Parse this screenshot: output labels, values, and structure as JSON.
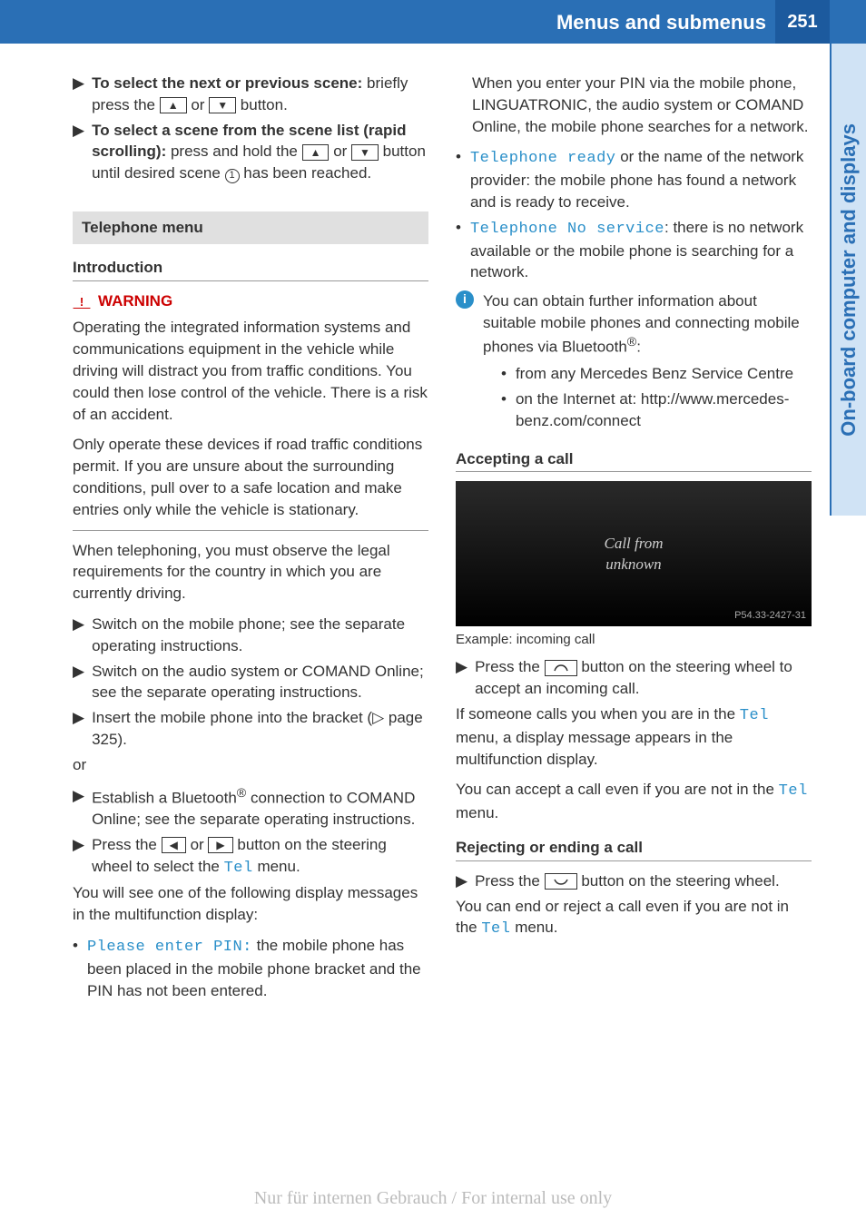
{
  "header": {
    "title": "Menus and submenus",
    "page_number": "251"
  },
  "side_tab": "On-board computer and displays",
  "left_col": {
    "instr1_bold": "To select the next or previous scene:",
    "instr1_rest_a": "briefly press the ",
    "instr1_rest_b": " or ",
    "instr1_rest_c": " button.",
    "instr2_bold": "To select a scene from the scene list (rapid scrolling):",
    "instr2_rest_a": " press and hold the ",
    "instr2_rest_b": " or ",
    "instr2_rest_c": " button until desired scene ",
    "instr2_rest_d": " has been reached.",
    "section_title": "Telephone menu",
    "subheading": "Introduction",
    "warning_label": "WARNING",
    "warning_p1": "Operating the integrated information systems and communications equipment in the vehicle while driving will distract you from traffic conditions. You could then lose control of the vehicle. There is a risk of an accident.",
    "warning_p2": "Only operate these devices if road traffic conditions permit. If you are unsure about the surrounding conditions, pull over to a safe location and make entries only while the vehicle is stationary.",
    "para1": "When telephoning, you must observe the legal requirements for the country in which you are currently driving.",
    "step1": "Switch on the mobile phone; see the separate operating instructions.",
    "step2": "Switch on the audio system or COMAND Online; see the separate operating instructions.",
    "step3_a": "Insert the mobile phone into the bracket (",
    "step3_b": " page 325).",
    "or": "or",
    "step4_a": "Establish a Bluetooth",
    "step4_b": " connection to COMAND Online; see the separate operating instructions.",
    "step5_a": "Press the ",
    "step5_b": " or ",
    "step5_c": " button on the steering wheel to select the ",
    "step5_tel": "Tel",
    "step5_d": " menu.",
    "para2": "You will see one of the following display messages in the multifunction display:",
    "bullet1_mono": "Please enter PIN:",
    "bullet1_rest": " the mobile phone has been placed in the mobile phone bracket and the PIN has not been entered."
  },
  "right_col": {
    "para1": "When you enter your PIN via the mobile phone, LINGUATRONIC, the audio system or COMAND Online, the mobile phone searches for a network.",
    "bullet1_mono": "Telephone ready",
    "bullet1_rest": " or the name of the network provider: the mobile phone has found a network and is ready to receive.",
    "bullet2_mono": "Telephone No service",
    "bullet2_rest": ": there is no network available or the mobile phone is searching for a network.",
    "info_text_a": "You can obtain further information about suitable mobile phones and connecting mobile phones via Bluetooth",
    "info_text_b": ":",
    "sub1": "from any Mercedes Benz Service Centre",
    "sub2": "on the Internet at: http://www.mercedes-benz.com/connect",
    "subheading2": "Accepting a call",
    "display_line1": "Call from",
    "display_line2": "unknown",
    "display_code": "P54.33-2427-31",
    "caption": "Example: incoming call",
    "step_accept_a": "Press the ",
    "step_accept_b": " button on the steering wheel to accept an incoming call.",
    "para2_a": "If someone calls you when you are in the ",
    "para2_tel": "Tel",
    "para2_b": " menu, a display message appears in the multifunction display.",
    "para3_a": "You can accept a call even if you are not in the ",
    "para3_tel": "Tel",
    "para3_b": " menu.",
    "subheading3": "Rejecting or ending a call",
    "step_reject_a": "Press the ",
    "step_reject_b": " button on the steering wheel.",
    "para4_a": "You can end or reject a call even if you are not in the ",
    "para4_tel": "Tel",
    "para4_b": " menu."
  },
  "footer": "Nur für internen Gebrauch / For internal use only"
}
